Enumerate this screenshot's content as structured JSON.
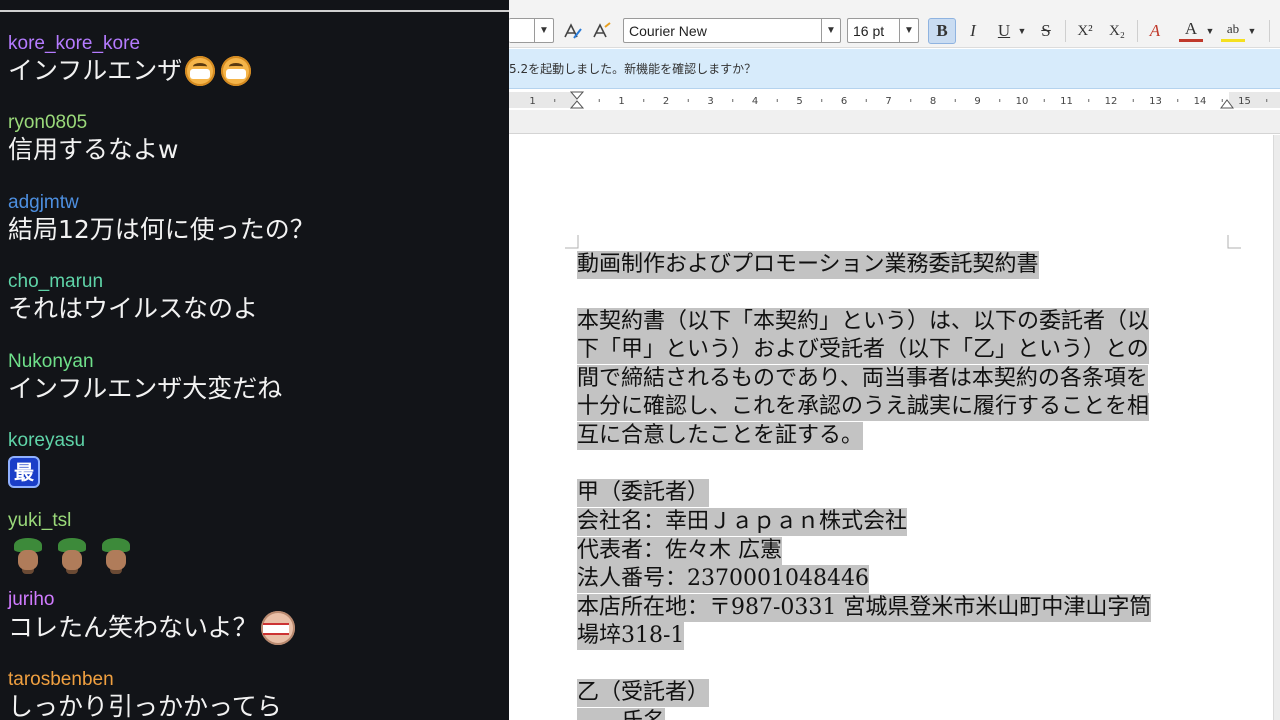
{
  "chat": {
    "messages": [
      {
        "user": "kore_kore_kore",
        "color": "#b57bff",
        "text": "インフルエンザ",
        "emotes": [
          "mask-face-icon",
          "mask-face-icon"
        ]
      },
      {
        "user": "ryon0805",
        "color": "#9ad97a",
        "text": "信用するなよw",
        "emotes": []
      },
      {
        "user": "adgjmtw",
        "color": "#4d8fe0",
        "text": "結局12万は何に使ったの？",
        "emotes": []
      },
      {
        "user": "cho_marun",
        "color": "#5fd4a8",
        "text": "それはウイルスなのよ",
        "emotes": []
      },
      {
        "user": "Nukonyan",
        "color": "#6fe08a",
        "text": "インフルエンザ大変だね",
        "emotes": []
      },
      {
        "user": "koreyasu",
        "color": "#5fd4a8",
        "text": "",
        "badge": "最",
        "emotes": []
      },
      {
        "user": "yuki_tsl",
        "color": "#9ad97a",
        "text": "",
        "emotes": [
          "gnome-icon",
          "gnome-icon",
          "gnome-icon"
        ]
      },
      {
        "user": "juriho",
        "color": "#d07bff",
        "text": "コレたん笑わないよ？",
        "emotes": [
          "bandaged-face-icon"
        ]
      },
      {
        "user": "tarosbenben",
        "color": "#f0a040",
        "text": "しっかり引っかかってら",
        "emotes": []
      }
    ]
  },
  "writer": {
    "font_name": "Courier New",
    "font_size": "16 pt",
    "buttons": {
      "bold": "B",
      "italic": "I",
      "underline": "U",
      "strike": "S",
      "superscript": "X²",
      "subscript": "X₂",
      "clear": "A",
      "font_color": "A",
      "highlight": "ab"
    },
    "infobar_text": "5.2を起動しました。新機能を確認しますか？",
    "ruler_numbers": [
      "1",
      "1",
      "2",
      "3",
      "4",
      "5",
      "6",
      "7",
      "8",
      "9",
      "10",
      "11",
      "12",
      "13",
      "14",
      "15"
    ],
    "document": {
      "lines": [
        "動画制作およびプロモーション業務委託契約書",
        "",
        "本契約書（以下「本契約」という）は、以下の委託者（以",
        "下「甲」という）および受託者（以下「乙」という）との",
        "間で締結されるものであり、両当事者は本契約の各条項を",
        "十分に確認し、これを承認のうえ誠実に履行することを相",
        "互に合意したことを証する。",
        "",
        "甲（委託者）",
        "会社名：幸田Ｊａｐａｎ株式会社",
        "代表者：佐々木 広憲",
        "法人番号：2370001048446",
        "本店所在地：〒987-0331 宮城県登米市米山町中津山字筒",
        "場埣318-1",
        "",
        "乙（受託者）",
        "　　氏名"
      ]
    }
  }
}
